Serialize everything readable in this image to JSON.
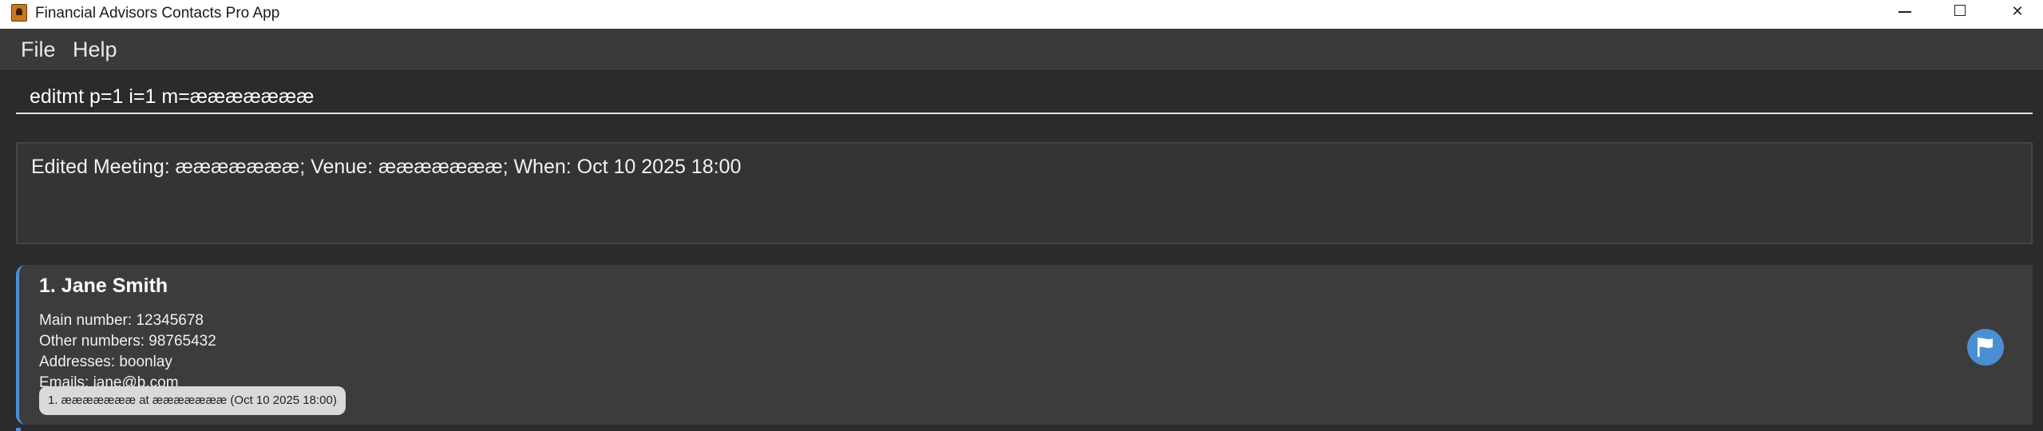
{
  "window": {
    "title": "Financial Advisors Contacts Pro App",
    "controls": [
      "minimize-icon",
      "maximize-icon",
      "close-icon"
    ]
  },
  "menu": {
    "file": "File",
    "help": "Help"
  },
  "command_box": {
    "value": "editmt p=1 i=1 m=æææææææ"
  },
  "result": {
    "text": "Edited Meeting: æææææææ; Venue: æææææææ; When: Oct 10 2025 18:00"
  },
  "persons": [
    {
      "name": "1. Jane Smith",
      "main_number": "Main number:  12345678",
      "other_numbers": "Other numbers:  98765432",
      "addresses": "Addresses:  boonlay",
      "emails": "Emails:  jane@b.com",
      "meeting_tag": "1. æææææææ at æææææææ (Oct 10 2025 18:00)",
      "flag_icon": "flag-icon",
      "accent_color": "#4a90d9"
    }
  ]
}
